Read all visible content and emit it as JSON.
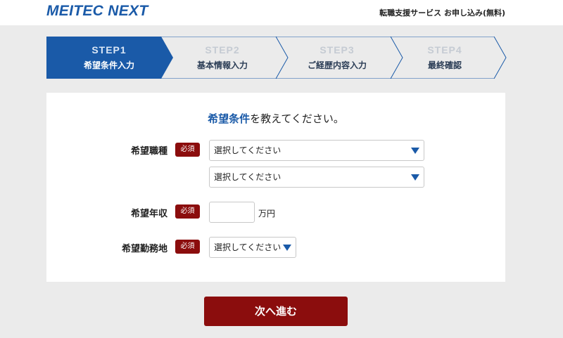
{
  "header": {
    "logo": "MEITEC NEXT",
    "title": "転職支援サービス お申し込み(無料)"
  },
  "steps": [
    {
      "num": "STEP1",
      "label": "希望条件入力",
      "active": true
    },
    {
      "num": "STEP2",
      "label": "基本情報入力",
      "active": false
    },
    {
      "num": "STEP3",
      "label": "ご経歴内容入力",
      "active": false
    },
    {
      "num": "STEP4",
      "label": "最終確認",
      "active": false
    }
  ],
  "form": {
    "title_highlight": "希望条件",
    "title_rest": "を教えてください。",
    "required_badge": "必須",
    "job_type": {
      "label": "希望職種",
      "select1": "選択してください",
      "select2": "選択してください"
    },
    "income": {
      "label": "希望年収",
      "value": "",
      "unit": "万円"
    },
    "location": {
      "label": "希望勤務地",
      "select": "選択してください"
    }
  },
  "next_button": "次へ進む",
  "colors": {
    "brand_blue": "#1a5aa8",
    "required_red": "#8b0d0d",
    "background": "#ebebeb"
  }
}
